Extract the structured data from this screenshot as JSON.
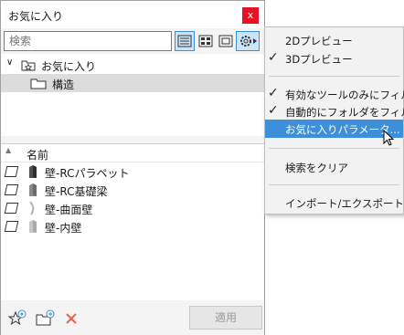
{
  "window": {
    "title": "お気に入り",
    "close_glyph": "x"
  },
  "search": {
    "placeholder": "検索"
  },
  "view_buttons": [
    {
      "icon": "list-view-icon",
      "active": true
    },
    {
      "icon": "grid-view-icon",
      "active": false
    },
    {
      "icon": "preview-view-icon",
      "active": false
    },
    {
      "icon": "gear-icon",
      "active": true
    }
  ],
  "tree": {
    "root": {
      "label": "お気に入り",
      "icon": "favorites-folder-icon"
    },
    "children": [
      {
        "label": "構造",
        "icon": "folder-icon",
        "selected": true
      }
    ]
  },
  "list": {
    "header": "名前",
    "items": [
      {
        "label": "壁-RCパラペット",
        "icon": "wall-icon"
      },
      {
        "label": "壁-RC基礎梁",
        "icon": "wall-icon"
      },
      {
        "label": "壁-曲面壁",
        "icon": "curved-wall-icon"
      },
      {
        "label": "壁-内壁",
        "icon": "wall-icon"
      }
    ]
  },
  "footer": {
    "buttons": [
      "add-favorite-icon",
      "new-folder-icon",
      "delete-icon"
    ],
    "apply_label": "適用"
  },
  "menu": {
    "items": [
      {
        "label": "2Dプレビュー",
        "checked": false
      },
      {
        "label": "3Dプレビュー",
        "checked": true
      },
      {
        "separator": true
      },
      {
        "label": "有効なツールのみにフィルタ",
        "checked": true
      },
      {
        "label": "自動的にフォルダをフィルタ",
        "checked": true
      },
      {
        "label": "お気に入りパラメータ...",
        "checked": false,
        "highlighted": true
      },
      {
        "separator": true
      },
      {
        "label": "検索をクリア",
        "checked": false
      },
      {
        "separator": true
      },
      {
        "label": "インポート/エクスポート...",
        "checked": false
      }
    ]
  },
  "colors": {
    "accent": "#3c8fd8",
    "close": "#e81123",
    "selection": "#dcdcdc",
    "delete": "#e8634a"
  }
}
